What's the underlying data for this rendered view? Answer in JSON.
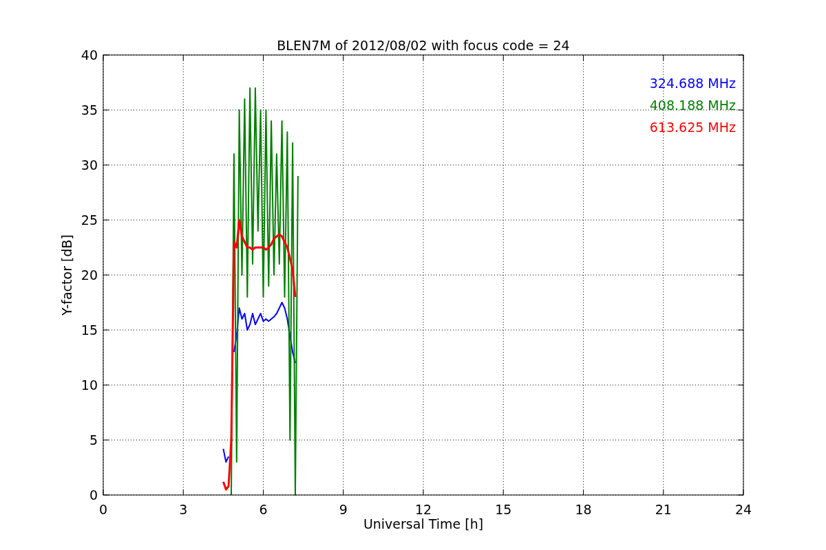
{
  "chart_data": {
    "type": "line",
    "title": "BLEN7M of 2012/08/02 with focus code = 24",
    "xlabel": "Universal Time [h]",
    "ylabel": "Y-factor [dB]",
    "x": [
      4.5,
      4.6,
      4.7,
      4.8,
      4.9,
      5.0,
      5.1,
      5.2,
      5.3,
      5.4,
      5.5,
      5.6,
      5.7,
      5.8,
      5.9,
      6.0,
      6.1,
      6.2,
      6.3,
      6.4,
      6.5,
      6.6,
      6.7,
      6.8,
      6.9,
      7.0,
      7.1,
      7.2,
      7.3
    ],
    "series": [
      {
        "name": "324.688 MHz",
        "color": "#0000ff",
        "values": [
          4.2,
          3.0,
          3.5,
          null,
          13,
          14.5,
          17,
          16,
          16.5,
          15,
          15.5,
          16.5,
          15.5,
          16,
          16.5,
          15.8,
          16,
          15.8,
          16,
          16.2,
          16.5,
          17,
          17.5,
          17,
          16,
          14.5,
          13,
          12,
          null
        ]
      },
      {
        "name": "408.188 MHz",
        "color": "#008000",
        "values": [
          null,
          null,
          null,
          0,
          31,
          3,
          35,
          20,
          36,
          18,
          37,
          21,
          37,
          24,
          35,
          18,
          35,
          19,
          34,
          20,
          31,
          21,
          34,
          18,
          33,
          5,
          32,
          0,
          29
        ]
      },
      {
        "name": "613.625 MHz",
        "color": "#ff0000",
        "values": [
          1.2,
          0.5,
          0.8,
          5,
          23,
          22.5,
          25,
          23.5,
          23,
          22.5,
          22.5,
          22.3,
          22.5,
          22.5,
          22.5,
          22.5,
          22.3,
          22.5,
          22.8,
          23.3,
          23.5,
          23.7,
          23.5,
          23,
          22.5,
          21.5,
          20.5,
          18,
          null
        ]
      }
    ],
    "grid": true,
    "xlim": [
      0,
      24
    ],
    "ylim": [
      0,
      40
    ],
    "xticks": [
      0,
      3,
      6,
      9,
      12,
      15,
      18,
      21,
      24
    ],
    "yticks": [
      0,
      5,
      10,
      15,
      20,
      25,
      30,
      35,
      40
    ]
  }
}
